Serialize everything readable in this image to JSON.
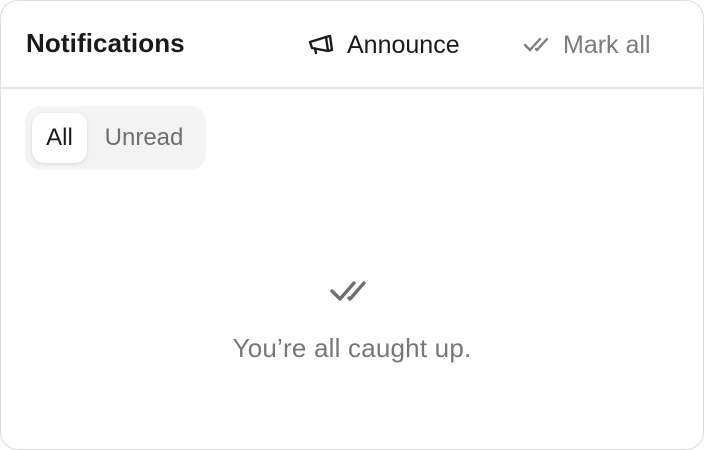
{
  "header": {
    "title": "Notifications",
    "announce_label": "Announce",
    "announce_icon": "megaphone-icon",
    "mark_all_label": "Mark all",
    "mark_all_icon": "double-check-icon"
  },
  "tabs": [
    {
      "label": "All",
      "selected": true
    },
    {
      "label": "Unread",
      "selected": false
    }
  ],
  "empty_state": {
    "icon": "double-check-icon",
    "message": "You’re all caught up."
  },
  "colors": {
    "text_primary": "#1a1a1a",
    "text_muted": "#7c7c7c",
    "tab_track": "#f3f3f3",
    "divider": "#e4e4e4"
  }
}
